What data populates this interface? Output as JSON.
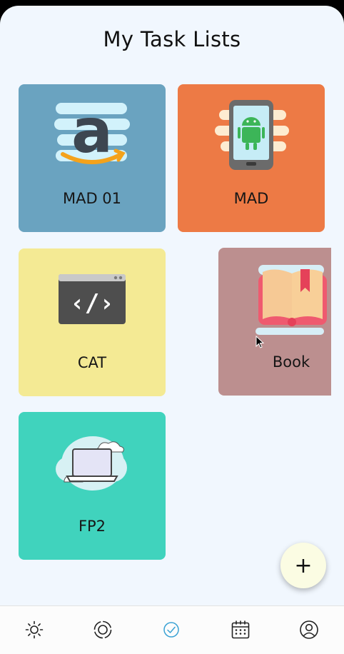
{
  "header": {
    "title": "My Task Lists"
  },
  "task_lists": [
    {
      "label": "MAD 01",
      "icon": "amazon-logo-icon",
      "color": "#6aa3c0"
    },
    {
      "label": "MAD",
      "icon": "android-phone-icon",
      "color": "#ed7a45"
    },
    {
      "label": "CAT",
      "icon": "code-window-icon",
      "color": "#f4ea94"
    },
    {
      "label": "Book",
      "icon": "open-book-icon",
      "color": "#bc8f8f"
    },
    {
      "label": "FP2",
      "icon": "laptop-cloud-icon",
      "color": "#40d3bd"
    }
  ],
  "fab": {
    "label": "+"
  },
  "bottom_nav": [
    {
      "icon": "sun-icon",
      "active": false
    },
    {
      "icon": "focus-icon",
      "active": false
    },
    {
      "icon": "check-circle-icon",
      "active": true
    },
    {
      "icon": "calendar-icon",
      "active": false
    },
    {
      "icon": "profile-icon",
      "active": false
    }
  ],
  "colors": {
    "background": "#f1f7fe",
    "active": "#3aa2d4",
    "fab": "#fbfce3"
  }
}
